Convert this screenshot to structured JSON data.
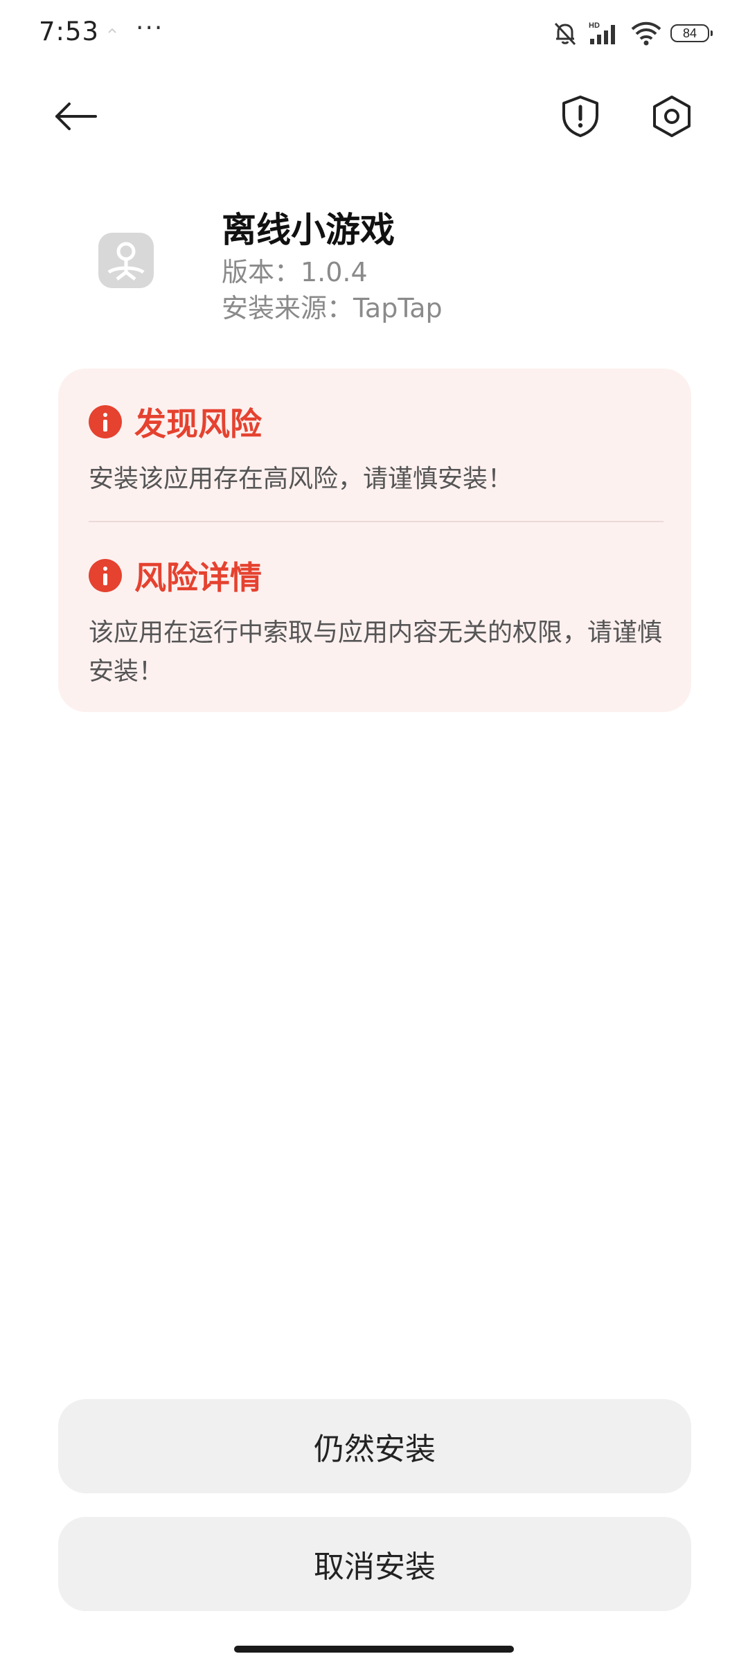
{
  "status_bar": {
    "time": "7:53",
    "dots": "···",
    "battery": "84",
    "icons": [
      "muted-bell-icon",
      "hd-signal-icon",
      "wifi-icon",
      "battery-icon"
    ]
  },
  "header": {
    "icons": [
      "back-arrow-icon",
      "shield-alert-icon",
      "settings-hex-icon"
    ]
  },
  "app": {
    "name": "离线小游戏",
    "version": "版本：1.0.4",
    "source": "安装来源：TapTap"
  },
  "risk": {
    "accent_color": "#e5422f",
    "card_color": "#fdf1f0",
    "found": {
      "title": "发现风险",
      "desc": "安装该应用存在高风险，请谨慎安装！"
    },
    "details": {
      "title": "风险详情",
      "desc": "该应用在运行中索取与应用内容无关的权限，请谨慎安装！"
    }
  },
  "actions": {
    "install_anyway": "仍然安装",
    "cancel_install": "取消安装"
  }
}
